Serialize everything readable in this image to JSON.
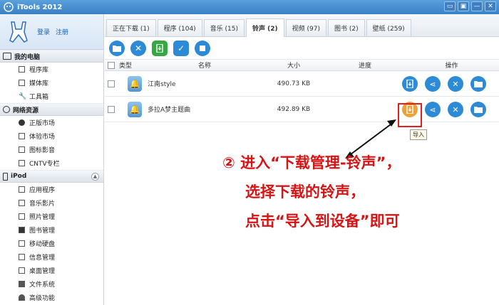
{
  "app": {
    "title": "iTools 2012"
  },
  "window_controls": [
    "▭",
    "▣",
    "—",
    "✕"
  ],
  "account": {
    "login": "登录",
    "register": "注册"
  },
  "sidebar": {
    "sections": [
      {
        "label": "我的电脑",
        "items": [
          "程序库",
          "媒体库",
          "工具箱"
        ]
      },
      {
        "label": "网络资源",
        "items": [
          "正版市场",
          "体验市场",
          "图标影音",
          "CNTV专栏"
        ]
      },
      {
        "label": "iPod",
        "items": [
          "应用程序",
          "音乐影片",
          "照片管理",
          "图书管理",
          "移动硬盘",
          "信息管理",
          "桌面管理",
          "文件系统",
          "高级功能"
        ]
      }
    ]
  },
  "tabs": [
    "正在下载 (1)",
    "程序 (104)",
    "音乐 (15)",
    "铃声 (2)",
    "视频 (97)",
    "图书 (2)",
    "壁纸 (259)"
  ],
  "active_tab": 3,
  "table": {
    "headers": {
      "type": "类型",
      "name": "名称",
      "size": "大小",
      "progress": "进度",
      "ops": "操作"
    },
    "rows": [
      {
        "name": "江南style",
        "size": "490.73 KB"
      },
      {
        "name": "多拉A梦主题曲",
        "size": "492.89 KB"
      }
    ]
  },
  "tooltip": "导入",
  "annotation": {
    "line1": "② 进入“下载管理-铃声”，",
    "line2": "选择下载的铃声，",
    "line3": "点击“导入到设备”即可"
  },
  "colors": {
    "accent": "#2d8ad6",
    "annotation": "#d51515",
    "highlight": "#e02020"
  }
}
